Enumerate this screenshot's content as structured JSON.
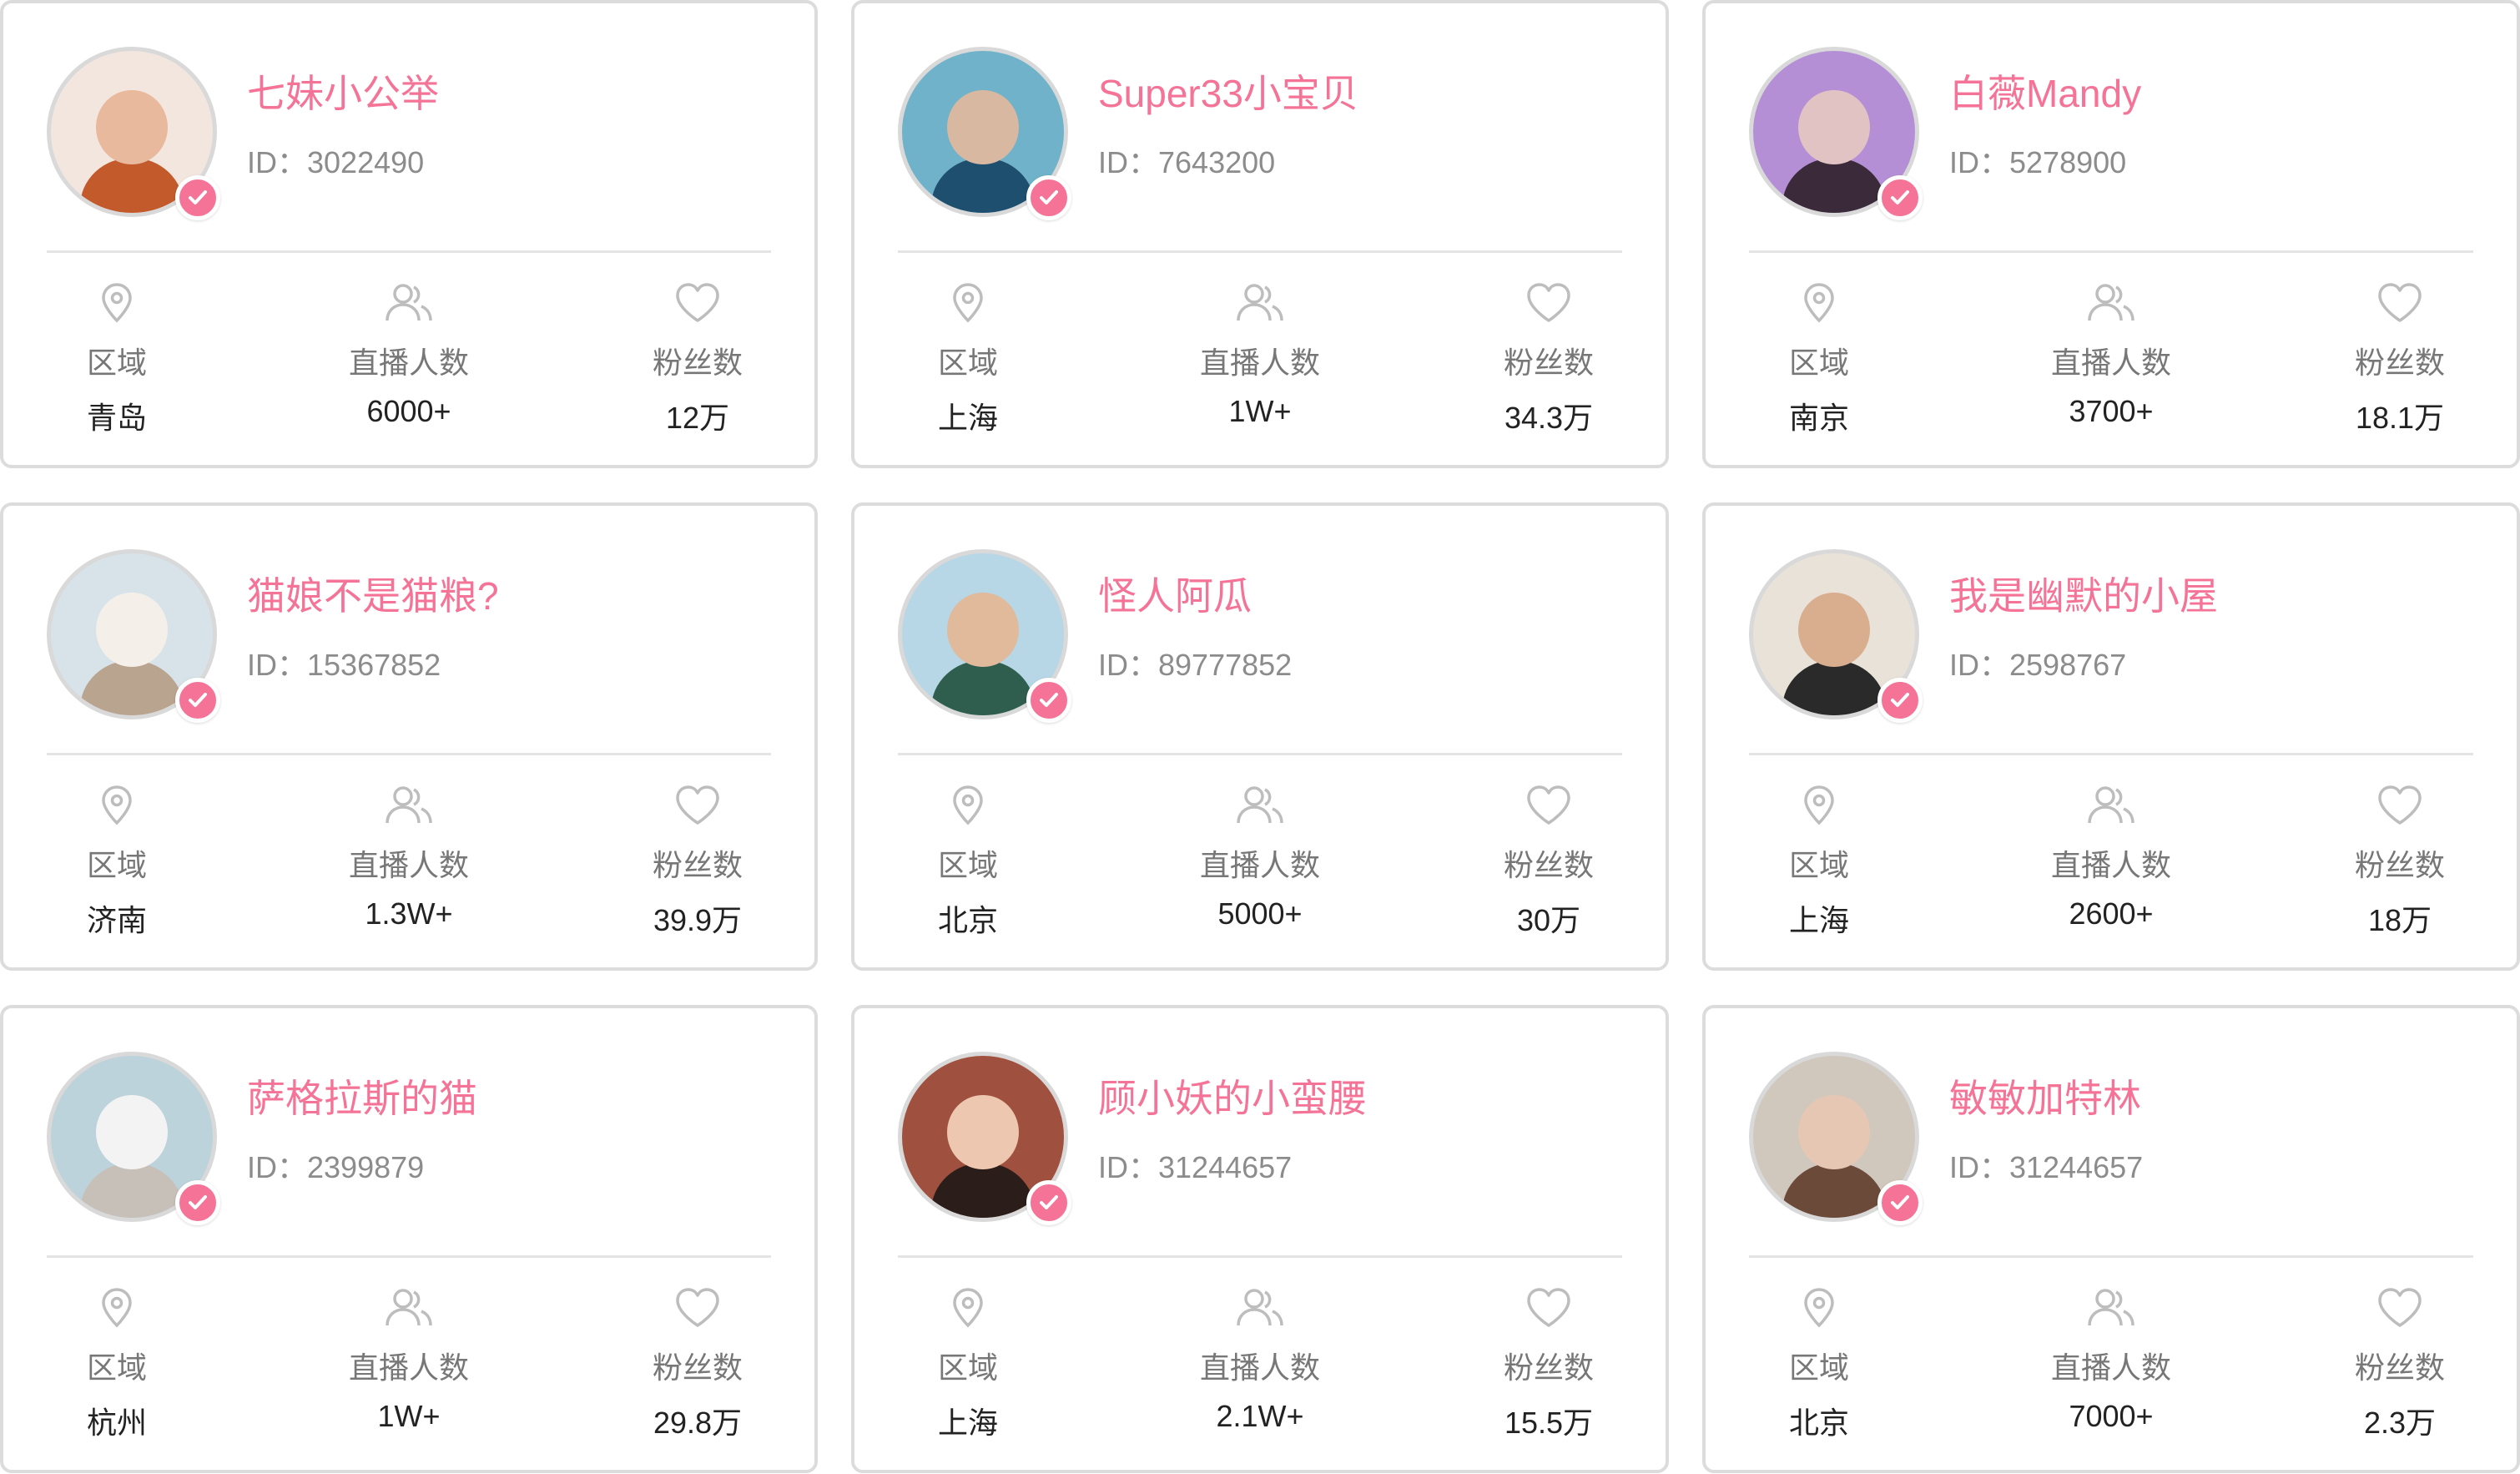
{
  "labels": {
    "region": "区域",
    "live_count": "直播人数",
    "fans": "粉丝数",
    "id_prefix": "ID："
  },
  "colors": {
    "accent": "#f47396",
    "label": "#777777",
    "value": "#222222",
    "border": "#dcdcdc"
  },
  "icons": {
    "region": "location-pin-icon",
    "live_count": "users-icon",
    "fans": "heart-icon",
    "badge": "verified-check-icon"
  },
  "streamers": [
    {
      "name": "七妹小公举",
      "id": "3022490",
      "region": "青岛",
      "live_count": "6000+",
      "fans": "12万"
    },
    {
      "name": "Super33小宝贝",
      "id": "7643200",
      "region": "上海",
      "live_count": "1W+",
      "fans": "34.3万"
    },
    {
      "name": "白薇Mandy",
      "id": "5278900",
      "region": "南京",
      "live_count": "3700+",
      "fans": "18.1万"
    },
    {
      "name": "猫娘不是猫粮?",
      "id": "15367852",
      "region": "济南",
      "live_count": "1.3W+",
      "fans": "39.9万"
    },
    {
      "name": "怪人阿瓜",
      "id": "89777852",
      "region": "北京",
      "live_count": "5000+",
      "fans": "30万"
    },
    {
      "name": "我是幽默的小屋",
      "id": "2598767",
      "region": "上海",
      "live_count": "2600+",
      "fans": "18万"
    },
    {
      "name": "萨格拉斯的猫",
      "id": "2399879",
      "region": "杭州",
      "live_count": "1W+",
      "fans": "29.8万"
    },
    {
      "name": "顾小妖的小蛮腰",
      "id": "31244657",
      "region": "上海",
      "live_count": "2.1W+",
      "fans": "15.5万"
    },
    {
      "name": "敏敏加特林",
      "id": "31244657",
      "region": "北京",
      "live_count": "7000+",
      "fans": "2.3万"
    }
  ]
}
